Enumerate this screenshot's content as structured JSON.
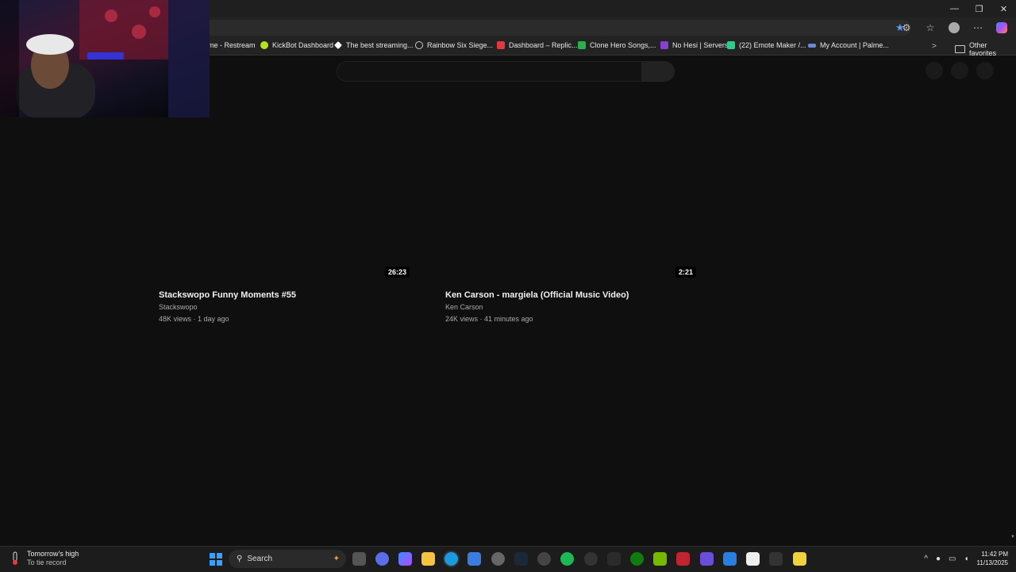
{
  "browser": {
    "window_controls": [
      "—",
      "❐",
      "✕"
    ],
    "bookmarks": [
      {
        "label": "me - Restream",
        "icon": "restream-icon",
        "color": "#1a1a1a"
      },
      {
        "label": "KickBot Dashboard",
        "icon": "kickbot-icon",
        "color": "#b9e21e"
      },
      {
        "label": "The best streaming...",
        "icon": "diamond-icon",
        "color": "#ffffff"
      },
      {
        "label": "Rainbow Six Siege...",
        "icon": "r6-icon",
        "color": "#cccccc"
      },
      {
        "label": "Dashboard – Replic...",
        "icon": "replic-icon",
        "color": "#e0393e"
      },
      {
        "label": "Clone Hero Songs,...",
        "icon": "plus-icon",
        "color": "#2ab14b"
      },
      {
        "label": "No Hesi | Servers",
        "icon": "nohesi-icon",
        "color": "#8b3fd1"
      },
      {
        "label": "(22) Emote Maker /...",
        "icon": "emote-icon",
        "color": "#2ccc8f"
      },
      {
        "label": "My Account | Palme...",
        "icon": "palme-icon",
        "color": "#6c89d6"
      }
    ],
    "other_favorites": "Other favorites"
  },
  "videos": [
    {
      "title": "Stackswopo Funny Moments #55",
      "channel": "Stackswopo",
      "meta": "48K views · 1 day ago",
      "duration": "26:23"
    },
    {
      "title": "Ken Carson - margiela (Official Music Video)",
      "channel": "Ken Carson",
      "meta": "24K views · 41 minutes ago",
      "duration": "2:21"
    }
  ],
  "taskbar": {
    "weather_title": "Tomorrow's high",
    "weather_sub": "To tie record",
    "search_label": "Search",
    "time": "11:42 PM",
    "date": "11/13/2025"
  }
}
